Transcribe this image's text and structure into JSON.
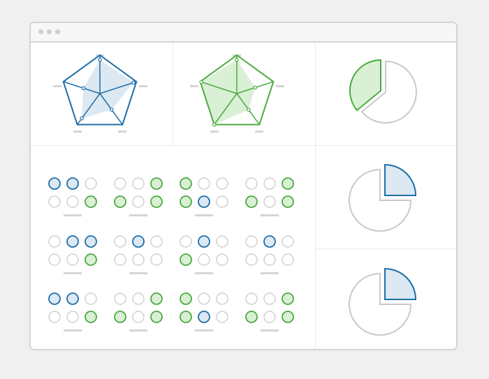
{
  "colors": {
    "blue": "#1f6ea8",
    "blue_fill": "#dce8f2",
    "green": "#4caa40",
    "green_fill": "#d9f0d5",
    "gray": "#d0d0d0",
    "gray_line": "#c9c9c9"
  },
  "window": {
    "controls": [
      "dot",
      "dot",
      "dot"
    ]
  },
  "radar_charts": [
    {
      "color": "blue",
      "values": [
        0.88,
        0.92,
        0.52,
        0.8,
        0.45
      ]
    },
    {
      "color": "green",
      "values": [
        0.88,
        0.5,
        0.52,
        1.0,
        0.97
      ]
    }
  ],
  "pie_charts": [
    {
      "color": "green",
      "fraction": 0.35,
      "highlight": "left"
    },
    {
      "color": "blue",
      "fraction": 0.25,
      "highlight": "top-right"
    },
    {
      "color": "blue",
      "fraction": 0.25,
      "highlight": "top-right"
    }
  ],
  "circle_grids": [
    [
      [
        "blue",
        "blue",
        "gray"
      ],
      [
        "gray",
        "gray",
        "green"
      ]
    ],
    [
      [
        "gray",
        "gray",
        "green"
      ],
      [
        "green",
        "gray",
        "green"
      ]
    ],
    [
      [
        "green",
        "gray",
        "gray"
      ],
      [
        "green",
        "blue",
        "gray"
      ]
    ],
    [
      [
        "gray",
        "gray",
        "green"
      ],
      [
        "green",
        "gray",
        "green"
      ]
    ],
    [
      [
        "gray",
        "blue",
        "blue"
      ],
      [
        "gray",
        "gray",
        "green"
      ]
    ],
    [
      [
        "gray",
        "blue",
        "gray"
      ],
      [
        "gray",
        "gray",
        "gray"
      ]
    ],
    [
      [
        "gray",
        "blue",
        "gray"
      ],
      [
        "green",
        "gray",
        "gray"
      ]
    ],
    [
      [
        "gray",
        "blue",
        "gray"
      ],
      [
        "gray",
        "gray",
        "gray"
      ]
    ],
    [
      [
        "blue",
        "blue",
        "gray"
      ],
      [
        "gray",
        "gray",
        "green"
      ]
    ],
    [
      [
        "gray",
        "gray",
        "green"
      ],
      [
        "green",
        "gray",
        "green"
      ]
    ],
    [
      [
        "green",
        "gray",
        "gray"
      ],
      [
        "green",
        "blue",
        "gray"
      ]
    ],
    [
      [
        "gray",
        "gray",
        "green"
      ],
      [
        "green",
        "gray",
        "green"
      ]
    ]
  ]
}
